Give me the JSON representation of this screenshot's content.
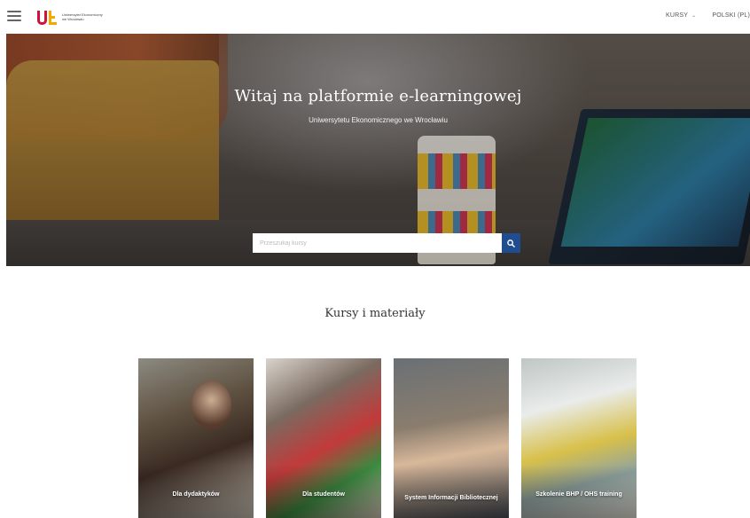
{
  "header": {
    "logo_text": "Uniwersytet Ekonomiczny we Wrocławiu",
    "nav": [
      {
        "label": "KURSY",
        "has_caret": true
      },
      {
        "label": "POLSKI (PL)",
        "has_caret": false
      }
    ]
  },
  "hero": {
    "title": "Witaj na platformie e-learningowej",
    "subtitle": "Uniwersytetu Ekonomicznego we Wrocławiu",
    "search_placeholder": "Przeszukaj kursy",
    "search_icon": "search-icon"
  },
  "section": {
    "title": "Kursy i materiały",
    "cards": [
      {
        "label": "Dla dydaktyków"
      },
      {
        "label": "Dla studentów"
      },
      {
        "label": "System Informacji Bibliotecznej"
      },
      {
        "label": "Szkolenie BHP / OHS training"
      }
    ]
  },
  "colors": {
    "brand_red": "#d2113b",
    "brand_yellow": "#f4a900",
    "search_button": "#1f4d8f"
  }
}
